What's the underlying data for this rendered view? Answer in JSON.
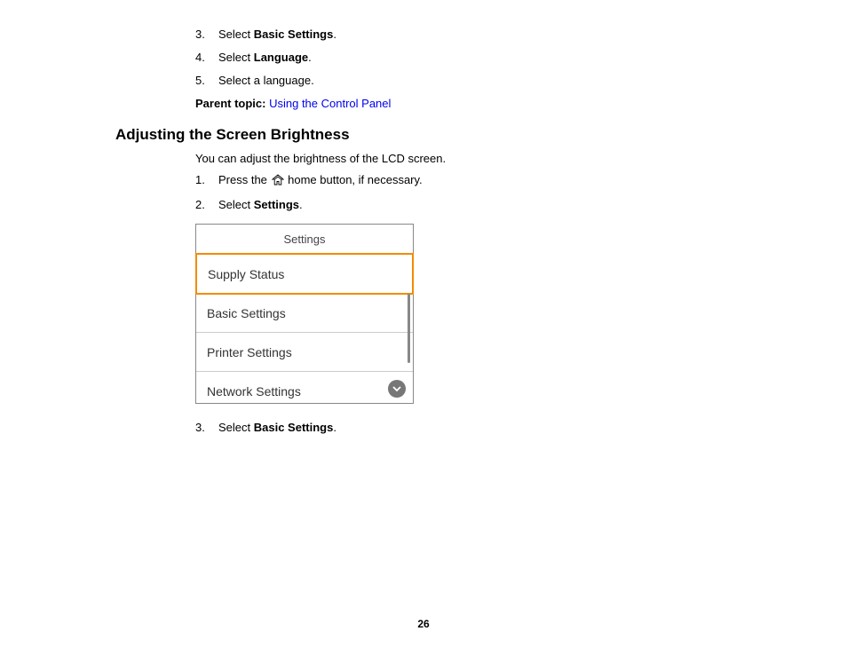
{
  "top_list": [
    {
      "num": "3.",
      "pre": "Select ",
      "bold": "Basic Settings",
      "post": "."
    },
    {
      "num": "4.",
      "pre": "Select ",
      "bold": "Language",
      "post": "."
    },
    {
      "num": "5.",
      "pre": "Select a language.",
      "bold": "",
      "post": ""
    }
  ],
  "parent_topic_label": "Parent topic:",
  "parent_topic_link": "Using the Control Panel",
  "section_heading": "Adjusting the Screen Brightness",
  "intro": "You can adjust the brightness of the LCD screen.",
  "steps": [
    {
      "num": "1.",
      "pre": "Press the ",
      "post": " home button, if necessary."
    },
    {
      "num": "2.",
      "pre": "Select ",
      "bold": "Settings",
      "post": "."
    }
  ],
  "ui": {
    "title": "Settings",
    "items": [
      "Supply Status",
      "Basic Settings",
      "Printer Settings",
      "Network Settings"
    ]
  },
  "step3": {
    "num": "3.",
    "pre": "Select ",
    "bold": "Basic Settings",
    "post": "."
  },
  "page_number": "26"
}
